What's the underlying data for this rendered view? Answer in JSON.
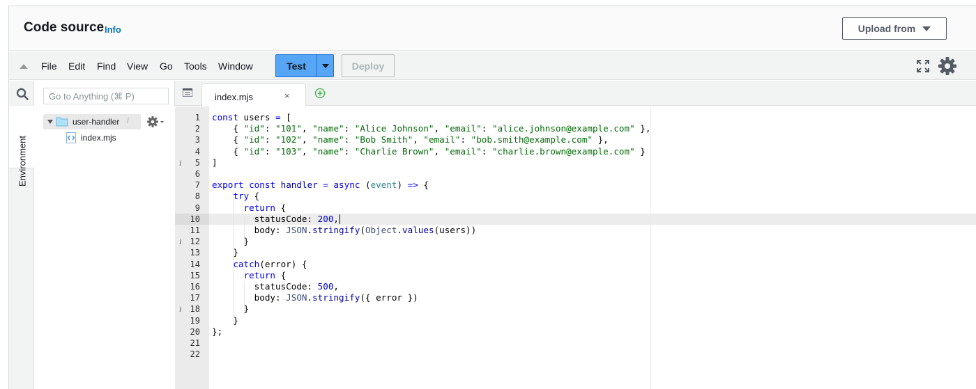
{
  "header": {
    "title": "Code source",
    "info_link": "Info",
    "upload_label": "Upload from"
  },
  "menu": {
    "items": [
      "File",
      "Edit",
      "Find",
      "View",
      "Go",
      "Tools",
      "Window"
    ],
    "test_label": "Test",
    "deploy_label": "Deploy",
    "icons": [
      "collapse-triangle-icon",
      "expand-fullscreen-icon",
      "settings-gear-icon"
    ]
  },
  "sidebar": {
    "environment_label": "Environment",
    "search_placeholder": "Go to Anything (⌘ P)",
    "folder": {
      "name": "user-handler",
      "path": "/"
    },
    "file": "index.mjs"
  },
  "editor": {
    "active_tab": "index.mjs",
    "active_line": 10,
    "info_marked_lines": [
      5,
      12,
      18
    ],
    "lines": [
      "const users = [",
      "    { \"id\": \"101\", \"name\": \"Alice Johnson\", \"email\": \"alice.johnson@example.com\" },",
      "    { \"id\": \"102\", \"name\": \"Bob Smith\", \"email\": \"bob.smith@example.com\" },",
      "    { \"id\": \"103\", \"name\": \"Charlie Brown\", \"email\": \"charlie.brown@example.com\" }",
      "]",
      "",
      "export const handler = async (event) => {",
      "    try {",
      "      return {",
      "        statusCode: 200,",
      "        body: JSON.stringify(Object.values(users))",
      "      }",
      "    }",
      "    catch(error) {",
      "      return {",
      "        statusCode: 500,",
      "        body: JSON.stringify({ error })",
      "      }",
      "    }",
      "};",
      "",
      ""
    ]
  },
  "colors": {
    "accent_blue": "#0073bb",
    "test_button": "#56a6f5",
    "keyword": "#0000ff",
    "string": "#036a07",
    "number": "#0000cd"
  }
}
